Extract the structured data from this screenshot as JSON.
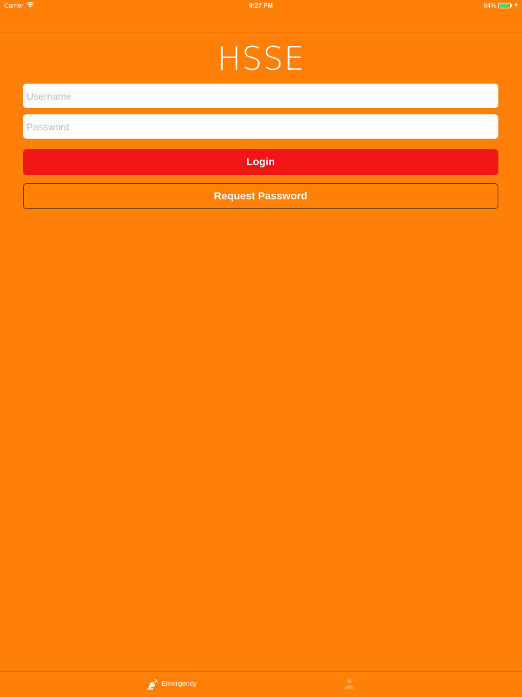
{
  "status_bar": {
    "carrier": "Carrier",
    "time": "9:27 PM",
    "battery_percent": "84%",
    "battery_level": 0.84,
    "battery_color": "#4cd964"
  },
  "header": {
    "title": "HSSE"
  },
  "form": {
    "username_placeholder": "Username",
    "username_value": "",
    "password_placeholder": "Password",
    "password_value": "",
    "login_label": "Login",
    "request_password_label": "Request Password"
  },
  "tab_bar": {
    "tabs": [
      {
        "label": "Emergency",
        "icon": "emergency-alarm-icon"
      },
      {
        "label": "",
        "icon": "person-icon"
      }
    ]
  },
  "colors": {
    "background": "#ff8008",
    "login_button": "#f31515",
    "text": "#ffffff"
  }
}
